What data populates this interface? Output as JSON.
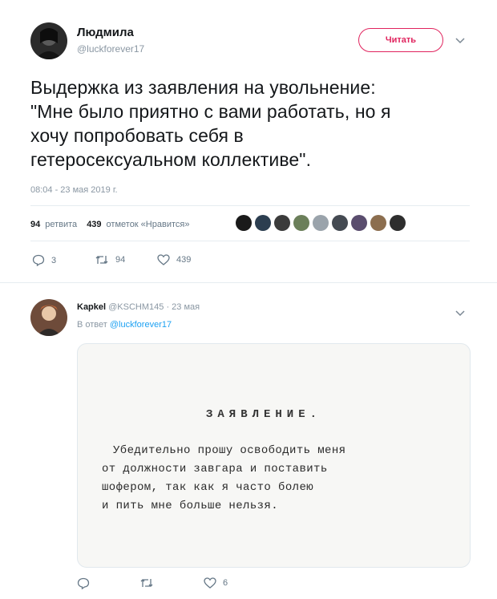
{
  "tweet": {
    "author_name": "Людмила",
    "author_handle": "@luckforever17",
    "follow_label": "Читать",
    "text_lines": [
      "Выдержка из заявления на увольнение:",
      "\"Мне было приятно с вами работать, но я",
      "хочу попробовать себя в",
      "гетеросексуальном коллективе\"."
    ],
    "timestamp": "08:04 - 23 мая 2019 г.",
    "retweets_count": "94",
    "retweets_label": "ретвита",
    "likes_count": "439",
    "likes_label": "отметок «Нравится»",
    "liker_avatar_colors": [
      "#1a1a1a",
      "#2c3e50",
      "#3b3b3b",
      "#6b7f5a",
      "#9aa3ab",
      "#444a52",
      "#5a4d6e",
      "#8c6e4f",
      "#2e2e2e"
    ],
    "actions": {
      "replies": "3",
      "retweets": "94",
      "likes": "439"
    }
  },
  "reply": {
    "author_name": "Kapkel",
    "author_handle": "@KSCHM145",
    "date": "· 23 мая",
    "reply_to_label": "В ответ",
    "reply_to_handle": "@luckforever17",
    "document": {
      "title": "ЗАЯВЛЕНИЕ.",
      "lines": [
        "Убедительно прошу освободить меня",
        "от должности завгара и поставить",
        "шофером, так как я часто болею",
        "и пить мне больше нельзя."
      ]
    },
    "actions": {
      "replies": "",
      "retweets": "",
      "likes": "6"
    }
  },
  "colors": {
    "accent": "#e0245e",
    "link": "#1da1f2",
    "muted": "#8a97a3"
  },
  "icons": [
    "chevron-down-icon",
    "reply-icon",
    "retweet-icon",
    "heart-icon"
  ]
}
